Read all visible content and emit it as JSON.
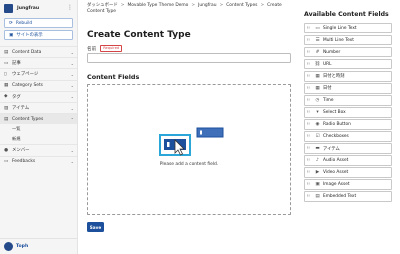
{
  "site": {
    "name": "Jungfrau"
  },
  "sidebar": {
    "rebuild_label": "Rebuild",
    "view_site_label": "サイトの表示",
    "items": [
      {
        "label": "Content Data",
        "icon": "content-data-icon"
      },
      {
        "label": "記事",
        "icon": "entry-icon"
      },
      {
        "label": "ウェブページ",
        "icon": "page-icon"
      },
      {
        "label": "Category Sets",
        "icon": "category-icon"
      },
      {
        "label": "タグ",
        "icon": "tag-icon"
      },
      {
        "label": "アイテム",
        "icon": "asset-icon"
      },
      {
        "label": "Content Types",
        "icon": "content-types-icon"
      }
    ],
    "sub_items": [
      {
        "label": "一覧"
      },
      {
        "label": "新規"
      }
    ],
    "items_after": [
      {
        "label": "メンバー",
        "icon": "user-icon"
      },
      {
        "label": "Feedbacks",
        "icon": "feedback-icon"
      }
    ],
    "user": {
      "name": "Toph"
    }
  },
  "breadcrumb": [
    "ダッシュボード",
    "Movable Type Theme Demo",
    "Jungfrau",
    "Content Types",
    "Create Content Type"
  ],
  "page_title": "Create Content Type",
  "form": {
    "name_label": "名前",
    "required_badge": "Required",
    "name_value": ""
  },
  "content_fields": {
    "title": "Content Fields",
    "empty_message": "Please add a content field."
  },
  "save_label": "Save",
  "available_fields": {
    "title": "Available Content Fields",
    "items": [
      {
        "label": "Single Line Text",
        "icon": "single-line-text-icon"
      },
      {
        "label": "Multi Line Text",
        "icon": "multi-line-text-icon"
      },
      {
        "label": "Number",
        "icon": "number-icon"
      },
      {
        "label": "URL",
        "icon": "url-icon"
      },
      {
        "label": "日付と時刻",
        "icon": "datetime-icon"
      },
      {
        "label": "日付",
        "icon": "date-icon"
      },
      {
        "label": "Time",
        "icon": "time-icon"
      },
      {
        "label": "Select Box",
        "icon": "select-box-icon"
      },
      {
        "label": "Radio Button",
        "icon": "radio-button-icon"
      },
      {
        "label": "Checkboxes",
        "icon": "checkbox-icon"
      },
      {
        "label": "アイテム",
        "icon": "asset-icon"
      },
      {
        "label": "Audio Asset",
        "icon": "audio-icon"
      },
      {
        "label": "Video Asset",
        "icon": "video-icon"
      },
      {
        "label": "Image Asset",
        "icon": "image-icon"
      },
      {
        "label": "Embedded Text",
        "icon": "embedded-text-icon"
      }
    ]
  },
  "colors": {
    "accent": "#1c4f9c",
    "required": "#d64545",
    "highlight": "#2aa7d8"
  }
}
